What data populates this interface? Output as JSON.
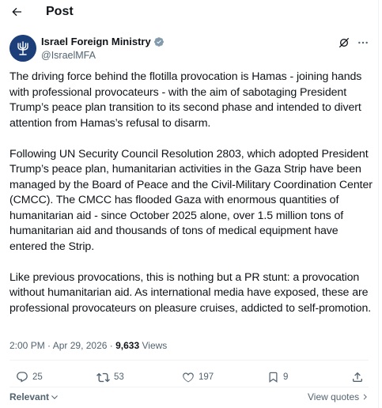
{
  "header": {
    "title": "Post"
  },
  "author": {
    "name": "Israel Foreign Ministry",
    "handle": "@IsraelMFA",
    "verified_badge_color": "#829aab"
  },
  "post": {
    "paragraphs": [
      "The driving force behind the flotilla provocation is Hamas - joining hands with professional provocateurs - with the aim of sabotaging President Trump’s peace plan transition to its second phase and intended to divert attention from Hamas’s refusal to disarm.",
      "Following UN Security Council Resolution 2803, which adopted President Trump’s peace plan, humanitarian activities in the Gaza Strip have been managed by the Board of Peace and the Civil-Military Coordination Center (CMCC). The CMCC has flooded Gaza with enormous quantities of humanitarian aid - since October 2025 alone, over 1.5 million tons of humanitarian aid and thousands of tons of medical equipment have entered the Strip.",
      "Like previous provocations, this is nothing but a PR stunt: a provocation without humanitarian aid. As international media have exposed, these are professional provocateurs on pleasure cruises, addicted to self-promotion."
    ],
    "time": "2:00 PM",
    "separator": "·",
    "date": "Apr 29, 2026",
    "views_count": "9,633",
    "views_label": "Views"
  },
  "actions": {
    "replies": "25",
    "reposts": "53",
    "likes": "197",
    "bookmarks": "9"
  },
  "footer": {
    "sort_label": "Relevant",
    "view_quotes_label": "View quotes"
  },
  "colors": {
    "text_primary": "#0f1419",
    "text_secondary": "#536471",
    "divider": "#eff3f4",
    "avatar_bg": "#1c3f7a"
  }
}
